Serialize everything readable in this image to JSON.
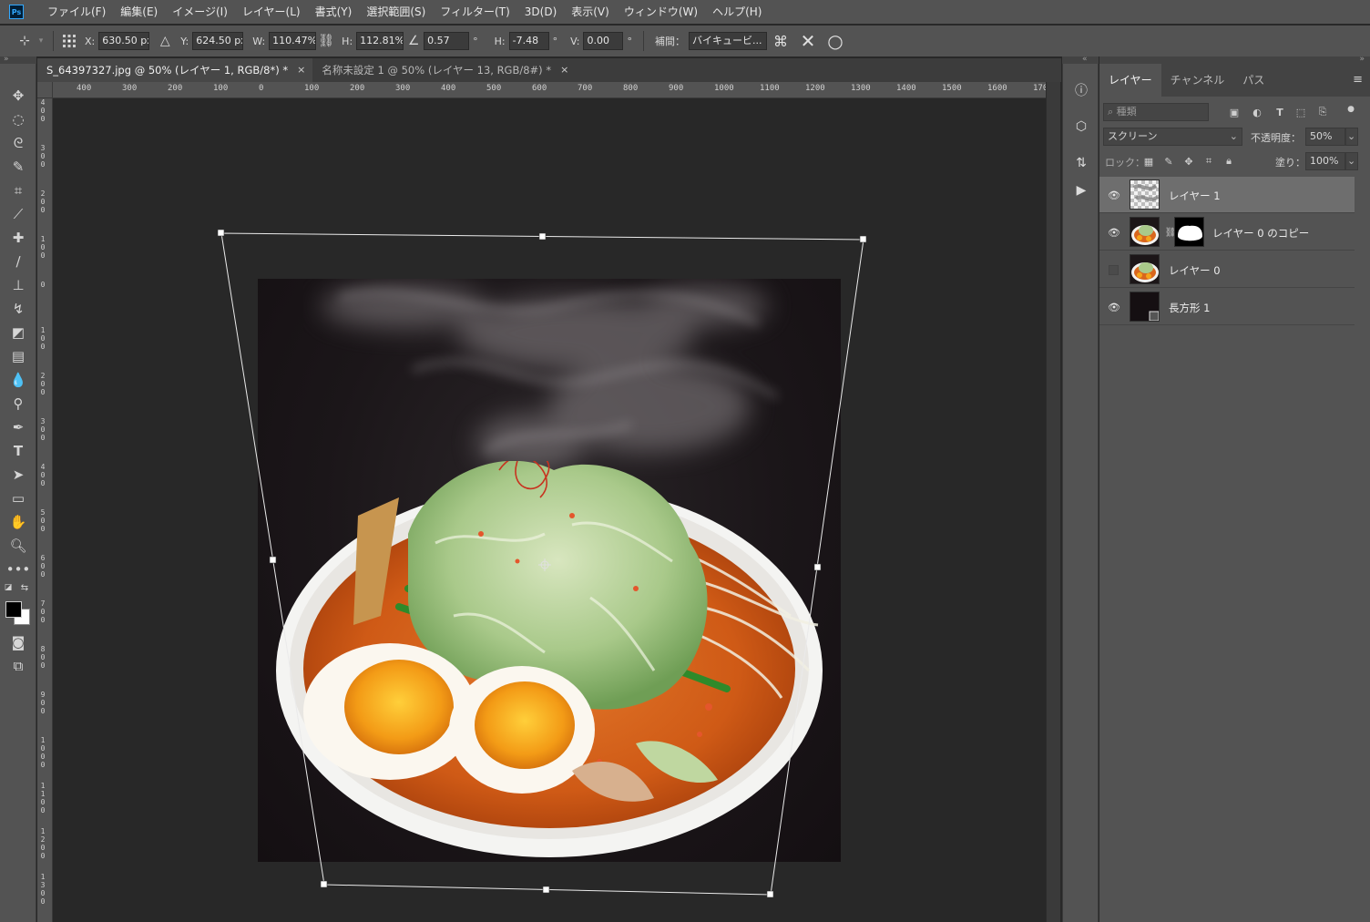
{
  "app": {
    "logo": "Ps",
    "menu": [
      "ファイル(F)",
      "編集(E)",
      "イメージ(I)",
      "レイヤー(L)",
      "書式(Y)",
      "選択範囲(S)",
      "フィルター(T)",
      "3D(D)",
      "表示(V)",
      "ウィンドウ(W)",
      "ヘルプ(H)"
    ]
  },
  "options": {
    "x_label": "X:",
    "x_value": "630.50 px",
    "y_label": "Y:",
    "y_value": "624.50 px",
    "w_label": "W:",
    "w_value": "110.47%",
    "h_label": "H:",
    "h_value": "112.81%",
    "angle_value": "0.57",
    "angle_unit": "°",
    "hskew_label": "H:",
    "hskew_value": "-7.48",
    "hskew_unit": "°",
    "vskew_label": "V:",
    "vskew_value": "0.00",
    "vskew_unit": "°",
    "interp_label": "補間：",
    "interp_value": "バイキュービ...",
    "cancel_icon": "✕",
    "commit_icon": "○"
  },
  "tabs": [
    {
      "label": "S_64397327.jpg @ 50% (レイヤー 1, RGB/8*) *",
      "active": true,
      "close": "×"
    },
    {
      "label": "名称未設定 1 @ 50% (レイヤー 13, RGB/8#) *",
      "active": false,
      "close": "×"
    }
  ],
  "ruler": {
    "h_labels": [
      "400",
      "300",
      "200",
      "100",
      "0",
      "100",
      "200",
      "300",
      "400",
      "500",
      "600",
      "700",
      "800",
      "900",
      "1000",
      "1100",
      "1200",
      "1300",
      "1400",
      "1500",
      "1600",
      "170"
    ],
    "v_labels": [
      "4\n0\n0",
      "3\n0\n0",
      "2\n0\n0",
      "1\n0\n0",
      "0",
      "1\n0\n0",
      "2\n0\n0",
      "3\n0\n0",
      "4\n0\n0",
      "5\n0\n0",
      "6\n0\n0",
      "7\n0\n0",
      "8\n0\n0",
      "9\n0\n0",
      "1\n0\n0\n0",
      "1\n1\n0\n0",
      "1\n2\n0\n0",
      "1\n3\n0\n0"
    ]
  },
  "panel": {
    "tabs": [
      "レイヤー",
      "チャンネル",
      "パス"
    ],
    "search_placeholder": "種類",
    "blend_mode": "スクリーン",
    "opacity_label": "不透明度：",
    "opacity_value": "50%",
    "lock_label": "ロック：",
    "fill_label": "塗り：",
    "fill_value": "100%",
    "layers": [
      {
        "name": "レイヤー 1",
        "visible": true,
        "selected": true
      },
      {
        "name": "レイヤー 0 のコピー",
        "visible": true,
        "selected": false
      },
      {
        "name": "レイヤー 0",
        "visible": false,
        "selected": false
      },
      {
        "name": "長方形 1",
        "visible": true,
        "selected": false
      }
    ]
  }
}
